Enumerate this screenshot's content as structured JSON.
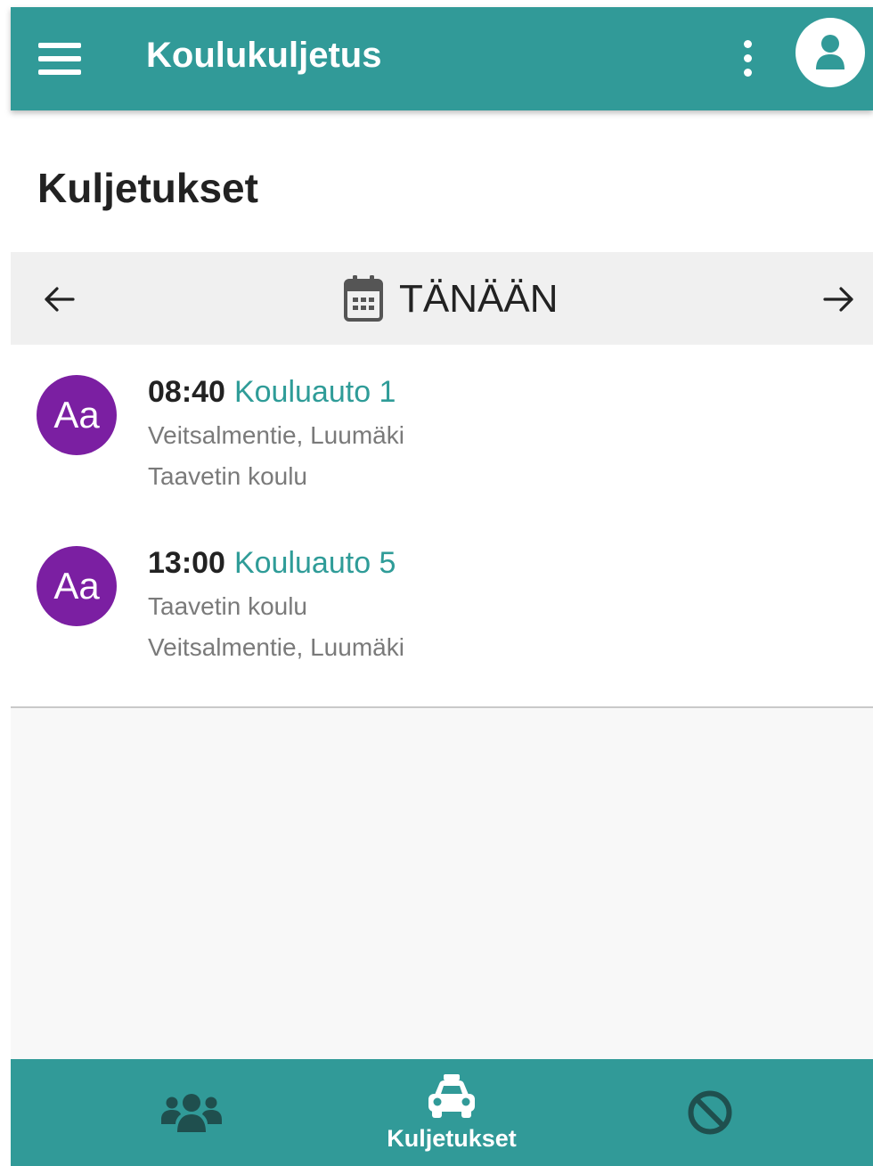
{
  "app_bar": {
    "title": "Koulukuljetus",
    "icons": {
      "menu": "menu-icon",
      "more": "more-vertical-icon",
      "account": "account-icon"
    },
    "color": "#319a98"
  },
  "page": {
    "title": "Kuljetukset"
  },
  "date_nav": {
    "label": "TÄNÄÄN",
    "icons": {
      "prev": "arrow-left-icon",
      "calendar": "calendar-icon",
      "next": "arrow-right-icon"
    }
  },
  "trips": [
    {
      "avatar": "Aa",
      "time": "08:40",
      "vehicle": "Kouluauto 1",
      "from": "Veitsalmentie, Luumäki",
      "to": "Taavetin koulu"
    },
    {
      "avatar": "Aa",
      "time": "13:00",
      "vehicle": "Kouluauto 5",
      "from": "Taavetin koulu",
      "to": "Veitsalmentie, Luumäki"
    }
  ],
  "bottom_nav": {
    "items": [
      {
        "icon": "users-icon",
        "label": ""
      },
      {
        "icon": "car-icon",
        "label": "Kuljetukset",
        "active": true
      },
      {
        "icon": "ban-icon",
        "label": ""
      }
    ]
  },
  "colors": {
    "accent": "#319a98",
    "avatar": "#7b1fa2",
    "vehicle_text": "#2f9c98"
  }
}
